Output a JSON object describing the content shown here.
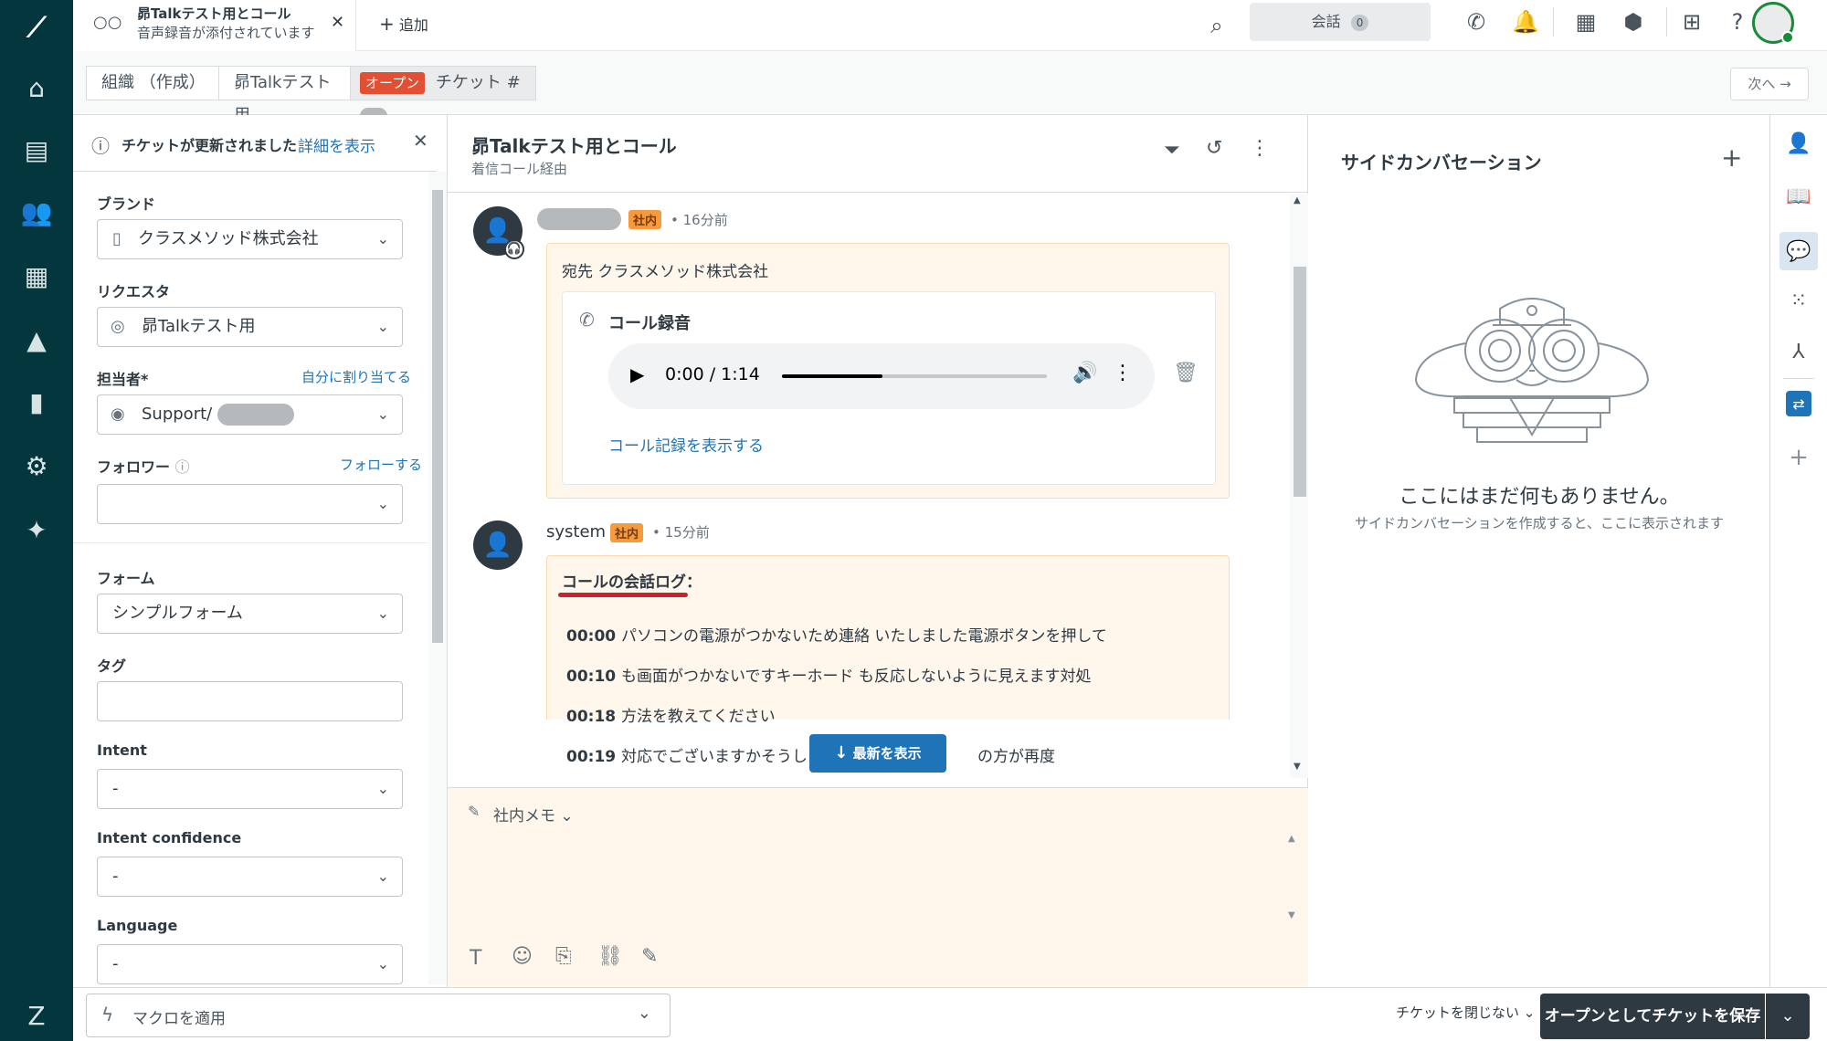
{
  "top": {
    "tab_title": "昴Talkテスト用とコール",
    "tab_subtitle": "音声録音が添付されています",
    "add_label": "追加",
    "conversations_label": "会話",
    "conversations_count": "0"
  },
  "crumbs": {
    "org": "組織 （作成）",
    "requester": "昴Talkテスト用",
    "status": "オープン",
    "ticket": "チケット #",
    "next": "次へ"
  },
  "left": {
    "notice": "チケットが更新されました",
    "notice_link": "詳細を表示",
    "brand_label": "ブランド",
    "brand_value": "クラスメソッド株式会社",
    "requester_label": "リクエスタ",
    "requester_value": "昴Talkテスト用",
    "assignee_label": "担当者*",
    "assign_self": "自分に割り当てる",
    "assignee_value": "Support/",
    "followers_label": "フォロワー",
    "follow_link": "フォローする",
    "form_label": "フォーム",
    "form_value": "シンプルフォーム",
    "tags_label": "タグ",
    "intent_label": "Intent",
    "intent_value": "-",
    "intent_conf_label": "Intent confidence",
    "intent_conf_value": "-",
    "language_label": "Language",
    "language_value": "-"
  },
  "center": {
    "title": "昴Talkテスト用とコール",
    "subtitle": "着信コール経由",
    "msg1_badge": "社内",
    "msg1_time": "16分前",
    "msg1_to": "宛先 クラスメソッド株式会社",
    "call_rec_title": "コール録音",
    "audio_time": "0:00 / 1:14",
    "call_log_link": "コール記録を表示する",
    "msg2_author": "system",
    "msg2_badge": "社内",
    "msg2_time": "15分前",
    "log_title": "コールの会話ログ：",
    "log": [
      {
        "t": "00:00",
        "text": "パソコンの電源がつかないため連絡 いたしました電源ボタンを押して"
      },
      {
        "t": "00:10",
        "text": "も画面がつかないですキーホード も反応しないように見えます対処"
      },
      {
        "t": "00:18",
        "text": "方法を教えてください"
      },
      {
        "t": "00:19",
        "text": "対応でございますかそうしまし",
        "tail": "の方が再度"
      }
    ],
    "show_latest": "最新を表示",
    "composer_mode": "社内メモ"
  },
  "right": {
    "title": "サイドカンバセーション",
    "empty_title": "ここにはまだ何もありません。",
    "empty_sub": "サイドカンバセーションを作成すると、ここに表示されます"
  },
  "bottom": {
    "macro": "マクロを適用",
    "close_toggle": "チケットを閉じない",
    "save": "オープンとしてチケットを保存"
  },
  "colors": {
    "rail": "#03363d",
    "accent": "#1f73b7",
    "open_badge": "#e34f32",
    "internal_bg": "#fff6ec",
    "save_btn": "#2f3941"
  }
}
